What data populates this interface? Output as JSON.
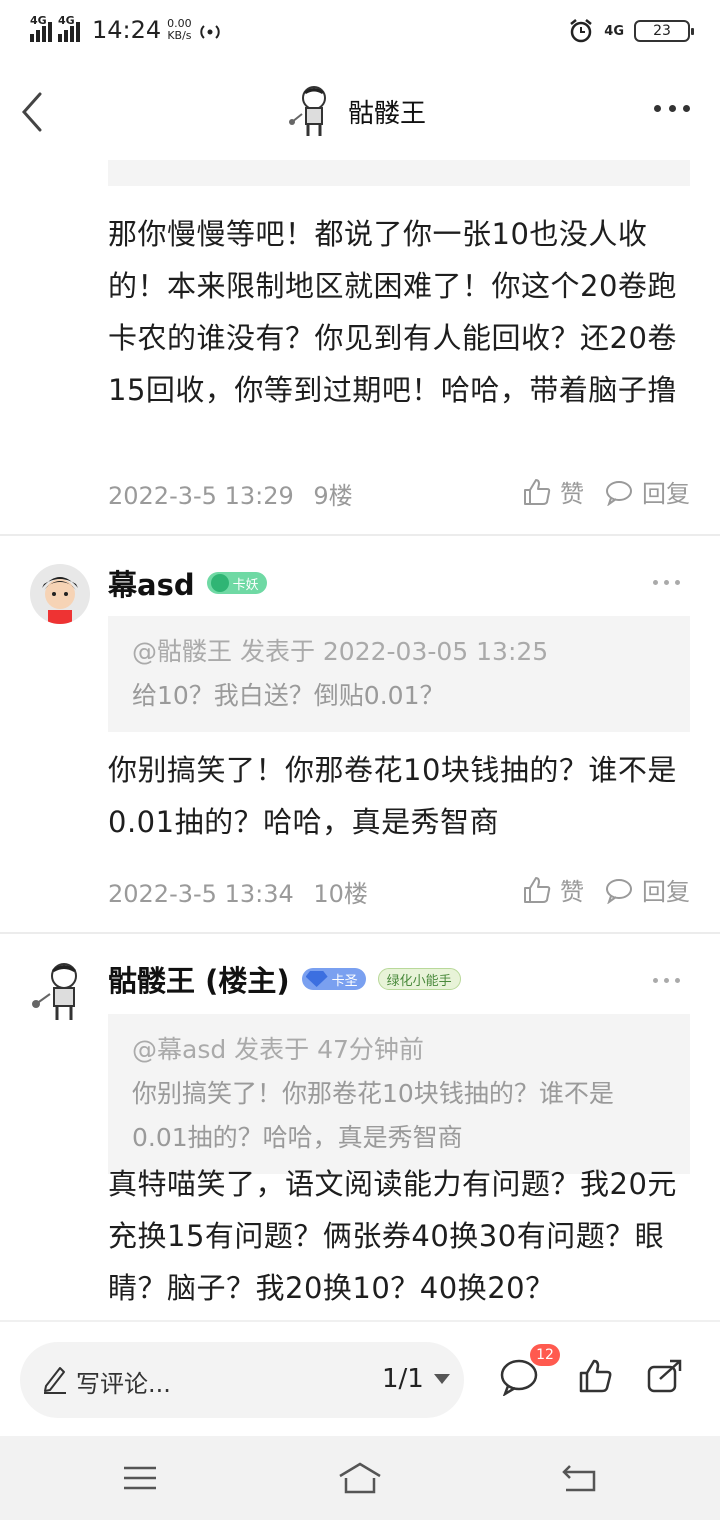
{
  "status": {
    "network1": "4G",
    "network2": "4G",
    "time": "14:24",
    "speed_value": "0.00",
    "speed_unit": "KB/s",
    "network_right": "4G",
    "battery": "23"
  },
  "nav": {
    "title": "骷髅王",
    "back_icon": "chevron-left-icon",
    "more_icon": "more-horizontal-icon"
  },
  "floors": [
    {
      "text": "那你慢慢等吧！都说了你一张10也没人收的！本来限制地区就困难了！你这个20卷跑卡农的谁没有？你见到有人能回收？还20卷15回收，你等到过期吧！哈哈，带着脑子撸",
      "date": "2022-3-5 13:29",
      "floor": "9楼",
      "like": "赞",
      "reply": "回复"
    },
    {
      "username": "幕asd",
      "badge": "卡妖",
      "quote_header": "@骷髅王 发表于 2022-03-05 13:25",
      "quote_body": "给10？我白送？倒贴0.01？",
      "text": "你别搞笑了！你那卷花10块钱抽的？谁不是0.01抽的？哈哈，真是秀智商",
      "date": "2022-3-5 13:34",
      "floor": "10楼",
      "like": "赞",
      "reply": "回复"
    },
    {
      "username": "骷髅王 (楼主)",
      "badge": "卡圣",
      "badge2": "绿化小能手",
      "quote_header": "@幕asd 发表于 47分钟前",
      "quote_body": "你别搞笑了！你那卷花10块钱抽的？谁不是0.01抽的？哈哈，真是秀智商",
      "text": "真特喵笑了，语文阅读能力有问题？我20元充换15有问题？俩张券40换30有问题？眼睛？脑子？我20换10？40换20？"
    }
  ],
  "bottom": {
    "comment_placeholder": "写评论...",
    "page": "1/1",
    "comment_count": "12"
  }
}
